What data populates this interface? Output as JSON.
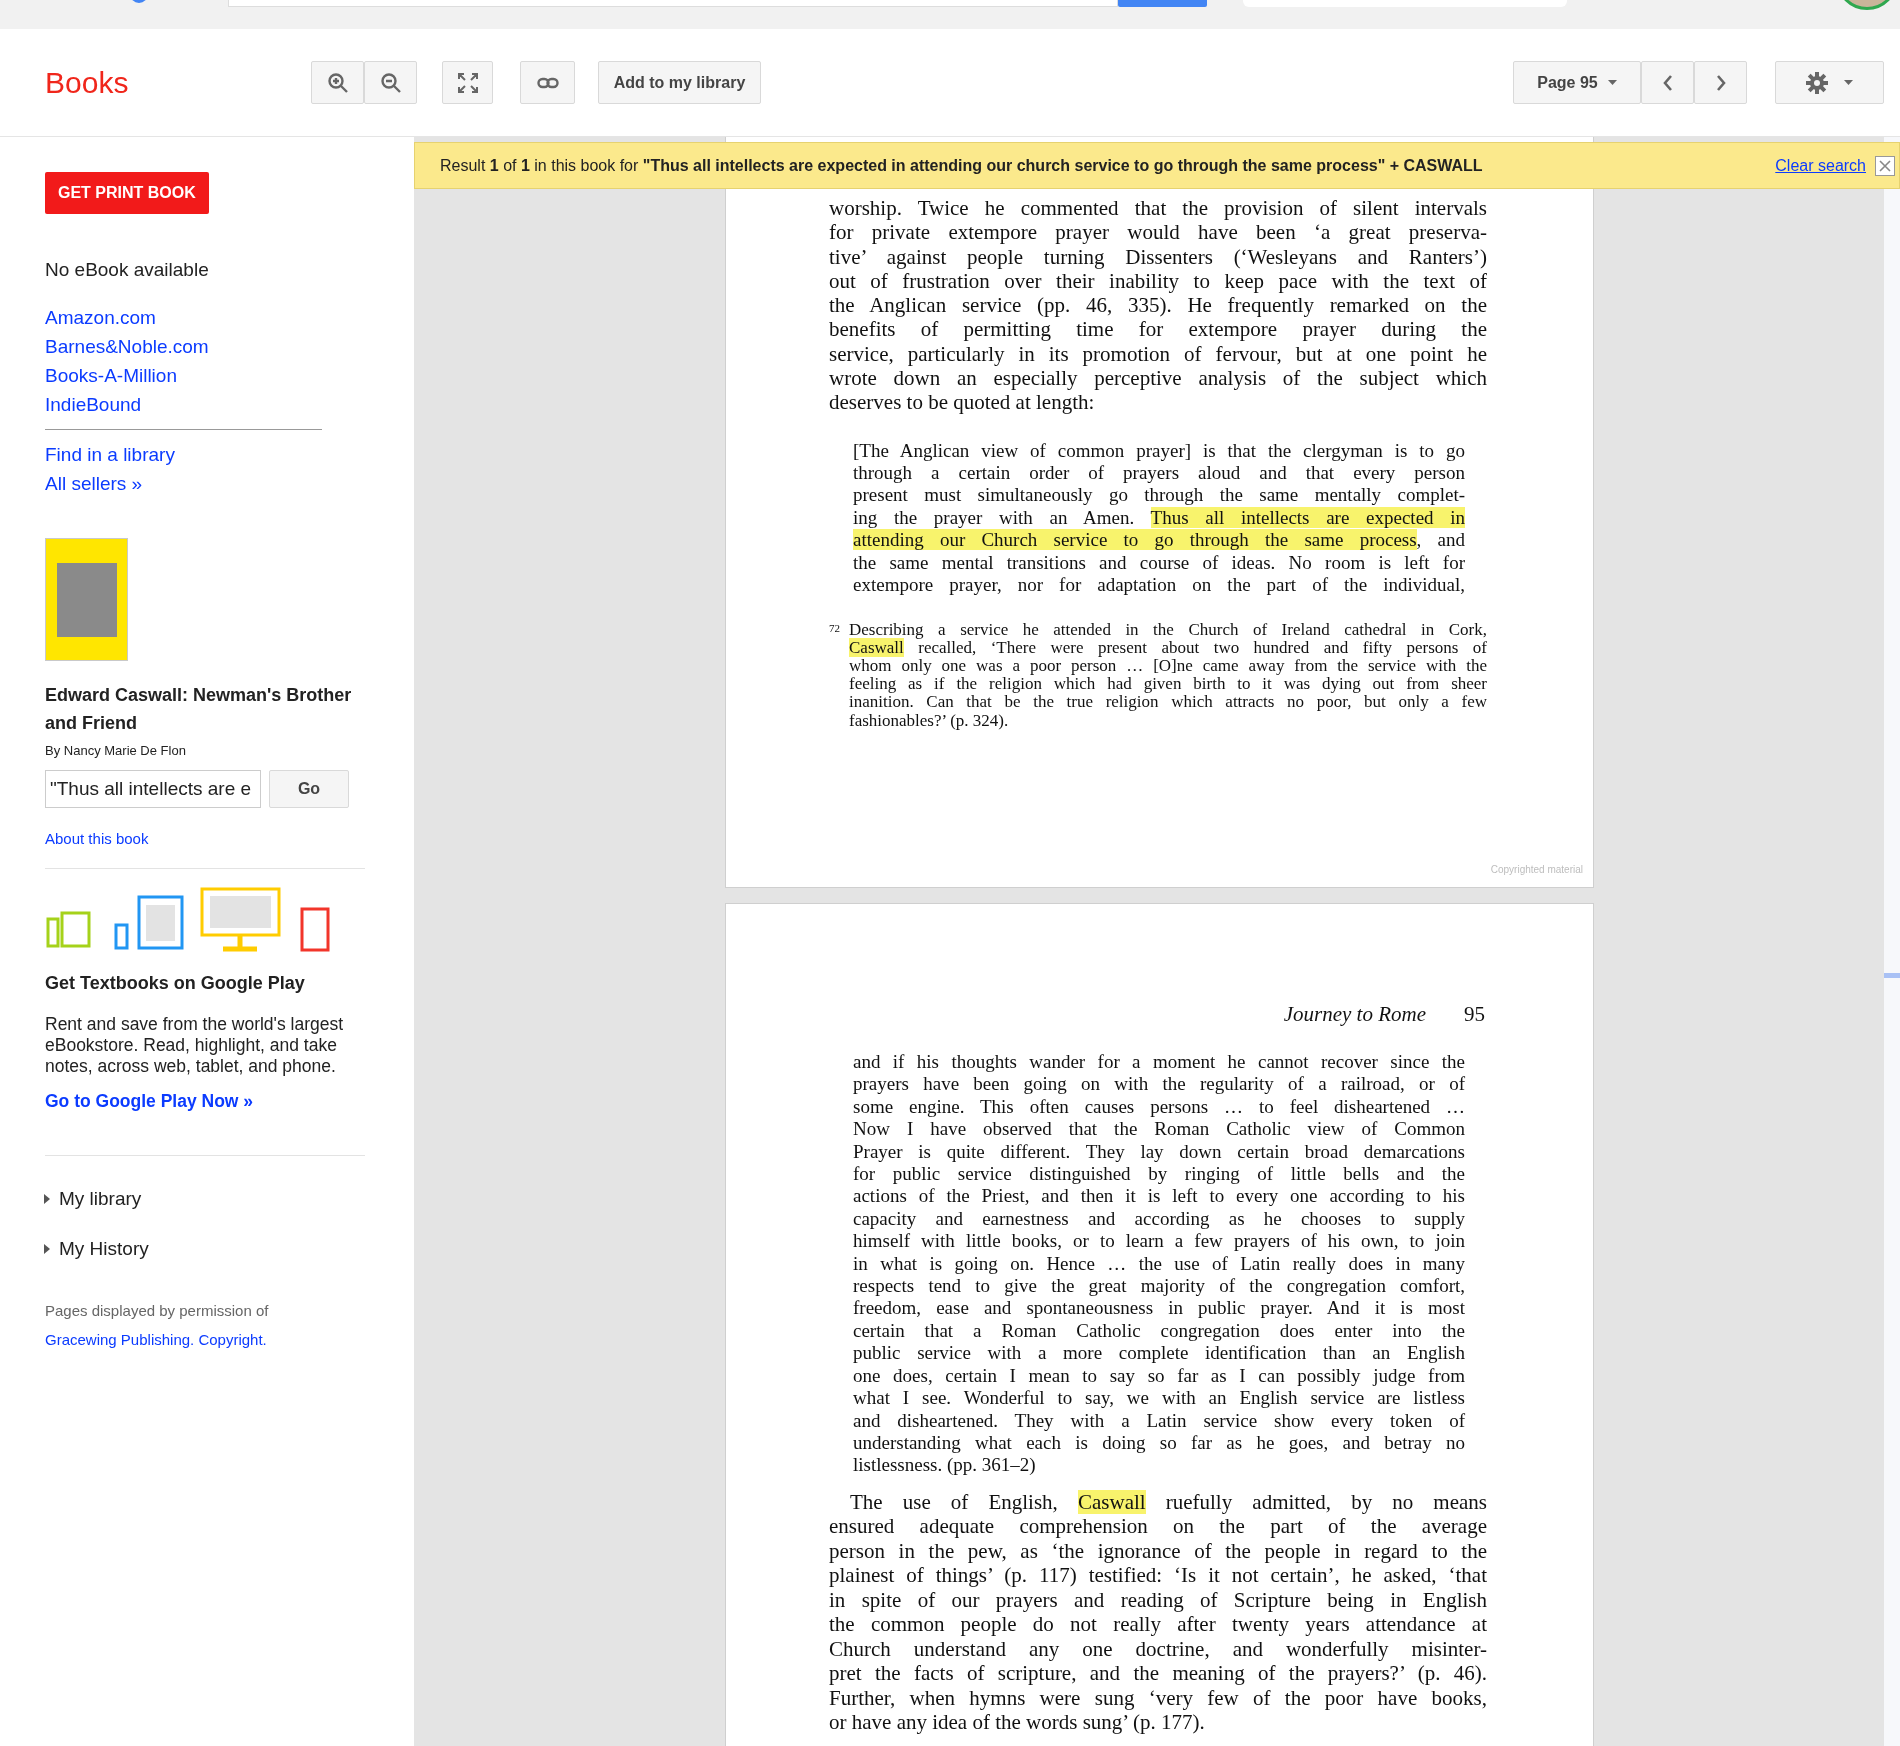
{
  "header": {
    "title": "Books",
    "add_button": "Add to my library",
    "page_select": "Page 95"
  },
  "search_banner": {
    "text": "Result **1** of **1** in this book for **\"Thus all intellects are expected in attending our church service to go through the same process\" + CASWALL**",
    "clear_link": "Clear search"
  },
  "sidebar": {
    "print_button": "GET PRINT BOOK",
    "ebook_status": "No eBook available",
    "sellers": [
      "Amazon.com",
      "Barnes&Noble.com",
      "Books-A-Million",
      "IndieBound"
    ],
    "library_links": [
      "Find in a library",
      "All sellers »"
    ],
    "book": {
      "title": "Edward Caswall: Newman's Brother and Friend",
      "author": "By Nancy Marie De Flon"
    },
    "search": {
      "value": "\"Thus all intellects are e",
      "button": "Go"
    },
    "about_link": "About this book",
    "promo": {
      "title": "Get Textbooks on Google Play",
      "text": "Rent and save from the world's largest eBookstore. Read, highlight, and take notes, across web, tablet, and phone.",
      "link": "Go to Google Play Now »"
    },
    "nav": [
      {
        "label": "My library",
        "expanded": false
      },
      {
        "label": "My History",
        "expanded": false
      }
    ],
    "permission": {
      "text": "Pages displayed by permission of",
      "links": [
        "Gracewing Publishing.",
        "Copyright."
      ]
    }
  },
  "pages": [
    {
      "blocks": [
        {
          "kind": "paragraph",
          "indent": false,
          "continues": false,
          "lines": [
            "worship. Twice he commented that the provision of silent intervals",
            "for private extempore prayer would have been ‘a great preserva-",
            "tive’ against people turning Dissenters (‘Wesleyans and Ranters’)",
            "out of frustration over their inability to keep pace with the text of",
            "the Anglican service (pp. 46, 335). He frequently remarked on the",
            "benefits of permitting time for extempore prayer during the",
            "service, particularly in its promotion of fervour, but at one point he",
            "wrote down an especially perceptive analysis of the subject which",
            "deserves to be quoted at length:"
          ]
        },
        {
          "kind": "quote",
          "indent": false,
          "continues": true,
          "lines": [
            "[The Anglican view of common prayer] is that the clergyman is to go",
            "through a certain order of prayers aloud and that every person",
            "present must simultaneously go through the same mentally complet-",
            [
              {
                "text": "ing the prayer with an Amen. ",
                "highlighted": false
              },
              {
                "text": "Thus all intellects are expected in",
                "highlighted": true
              }
            ],
            [
              {
                "text": "attending our Church service to go through the same process",
                "highlighted": true
              },
              {
                "text": ", and",
                "highlighted": false
              }
            ],
            "the same mental transitions and course of ideas. No room is left for",
            "extempore prayer, nor for adaptation on the part of the individual,"
          ]
        },
        {
          "kind": "footnote",
          "number": "72",
          "indent": false,
          "continues": false,
          "lines": [
            "Describing a service he attended in the Church of Ireland cathedral in Cork,",
            [
              {
                "text": "Caswall",
                "highlighted": true
              },
              {
                "text": " recalled, ‘There were present about two hundred and fifty persons of",
                "highlighted": false
              }
            ],
            "whom only one was a poor person … [O]ne came away from the service with the",
            "feeling as if the religion which had given birth to it was dying out from sheer",
            "inanition. Can that be the true religion which attracts no poor, but only a few",
            "fashionables?’ (p. 324)."
          ]
        }
      ],
      "footer_mark": "Copyrighted material"
    },
    {
      "running_head": "Journey to Rome",
      "page_number": "95",
      "blocks": [
        {
          "kind": "quote",
          "indent": false,
          "continues": false,
          "lines": [
            "and if his thoughts wander for a moment he cannot recover since the",
            "prayers have been going on with the regularity of a railroad, or of",
            "some engine. This often causes persons … to feel disheartened …",
            "Now I have observed that the Roman Catholic view of Common",
            "Prayer is quite different. They lay down certain broad demarcations",
            "for public service distinguished by ringing of little bells and the",
            "actions of the Priest, and then it is left to every one according to his",
            "capacity and earnestness and according as he chooses to supply",
            "himself with little books, or to learn a few prayers of his own, to join",
            "in what is going on. Hence … the use of Latin really does in many",
            "respects tend to give the great majority of the congregation comfort,",
            "freedom, ease and spontaneousness in public prayer. And it is most",
            "certain that a Roman Catholic congregation does enter into the",
            "public service with a more complete identification than an English",
            "one does, certain I mean to say so far as I can possibly judge from",
            "what I see. Wonderful to say, we with an English service are listless",
            "and disheartened. They with a Latin service show every token of",
            "understanding what each is doing so far as he goes, and betray no",
            "listlessness. (pp. 361–2)"
          ]
        },
        {
          "kind": "paragraph",
          "indent": true,
          "continues": false,
          "lines": [
            [
              {
                "text": "The use of English, ",
                "highlighted": false
              },
              {
                "text": "Caswall",
                "highlighted": true
              },
              {
                "text": " ruefully admitted, by no means",
                "highlighted": false
              }
            ],
            "ensured adequate comprehension on the part of the average",
            "person in the pew, as ‘the ignorance of the people in regard to the",
            "plainest of things’ (p. 117) testified: ‘Is it not certain’, he asked, ‘that",
            "in spite of our prayers and reading of Scripture being in English",
            "the common people do not really after twenty years attendance at",
            "Church understand any one doctrine, and wonderfully misinter-",
            "pret the facts of scripture, and the meaning of the prayers?’ (p. 46).",
            "Further, when hymns were sung ‘very few of the poor have books,",
            "or have any idea of the words sung’ (p. 177)."
          ]
        }
      ]
    }
  ]
}
